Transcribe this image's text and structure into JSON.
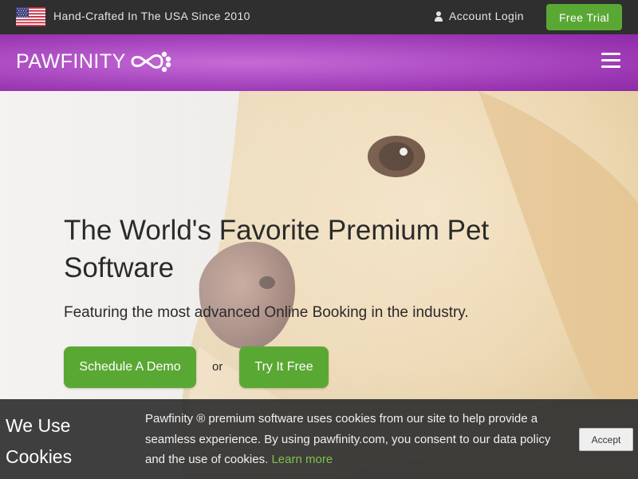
{
  "topbar": {
    "tagline": "Hand-Crafted In The USA Since 2010",
    "account_login": "Account Login",
    "free_trial": "Free Trial"
  },
  "nav": {
    "logo_text": "PAWFINITY",
    "menu_icon": "hamburger-menu-icon"
  },
  "hero": {
    "title": "The World's Favorite Premium Pet Software",
    "subtitle": "Featuring the most advanced Online Booking in the industry.",
    "demo_button": "Schedule A Demo",
    "or": "or",
    "try_button": "Try It Free"
  },
  "cookie": {
    "title": "We Use Cookies",
    "text": "Pawfinity ® premium software uses cookies from our site to help provide a seamless experience. By using pawfinity.com, you consent to our data policy and the use of cookies.",
    "learn_more": "Learn more",
    "accept": "Accept"
  },
  "colors": {
    "topbar_bg": "#2f2f2f",
    "brand_purple": "#b153c7",
    "accent_green": "#5aa834",
    "link_green": "#7ec24a"
  },
  "icons": [
    "us-flag-icon",
    "user-icon",
    "pawfinity-logo-icon",
    "hamburger-menu-icon"
  ]
}
